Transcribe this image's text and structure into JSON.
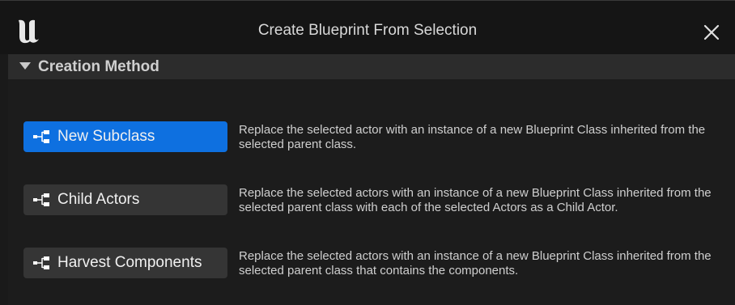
{
  "window": {
    "title": "Create Blueprint From Selection"
  },
  "section": {
    "title": "Creation Method"
  },
  "methods": [
    {
      "label": "New Subclass",
      "description": "Replace the selected actor with an instance of a new Blueprint Class inherited from the selected parent class.",
      "selected": true
    },
    {
      "label": "Child Actors",
      "description": "Replace the selected actors with an instance of a new Blueprint Class inherited from the selected parent class with each of the selected Actors as a Child Actor.",
      "selected": false
    },
    {
      "label": "Harvest Components",
      "description": "Replace the selected actors with an instance of a new Blueprint Class inherited from the selected parent class that contains the components.",
      "selected": false
    }
  ],
  "icons": {
    "logo": "unreal-engine-logo",
    "close": "close-icon",
    "collapse": "triangle-down-icon",
    "method": "hierarchy-icon"
  },
  "colors": {
    "accent": "#0e70e0",
    "background": "#1a1a1a",
    "button": "#353535",
    "text": "#cfcfcf"
  }
}
